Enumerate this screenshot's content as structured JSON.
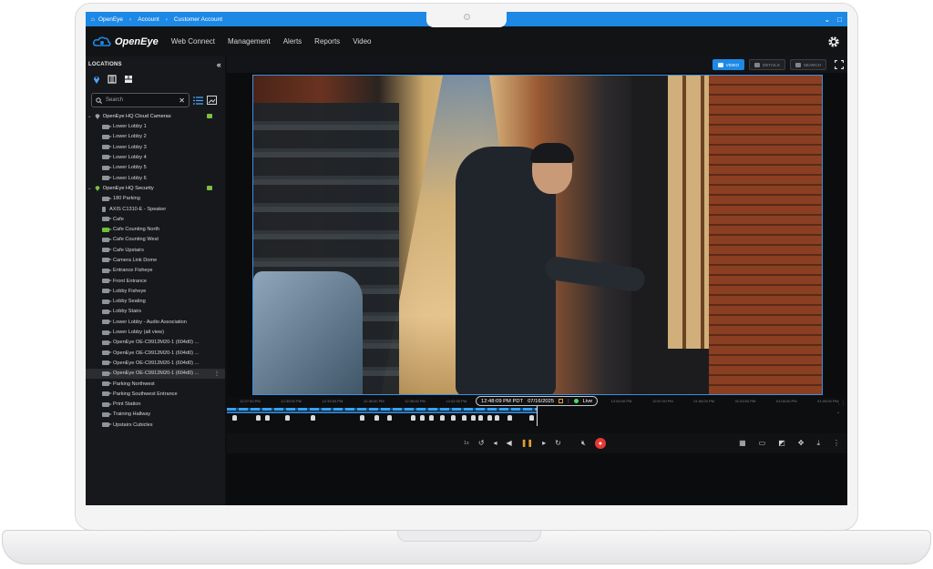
{
  "browser": {
    "crumbs": [
      "OpenEye",
      "Account",
      "Customer Account"
    ]
  },
  "header": {
    "brand": "OpenEye",
    "nav": [
      "Web Connect",
      "Management",
      "Alerts",
      "Reports",
      "Video"
    ]
  },
  "sidebar": {
    "title": "LOCATIONS",
    "search_placeholder": "Search",
    "groups": [
      {
        "label": "OpenEye HQ Cloud Cameras",
        "cameras": [
          "Lower Lobby 1",
          "Lower Lobby 2",
          "Lower Lobby 3",
          "Lower Lobby 4",
          "Lower Lobby 5",
          "Lower Lobby 6"
        ]
      },
      {
        "label": "OpenEye HQ Security",
        "cameras": [
          "180 Parking",
          "AXIS C1310-E - Speaker",
          "Cafe",
          "Cafe Counting North",
          "Cafe Counting West",
          "Cafe Upstairs",
          "Camera Link Dome",
          "Entrance Fisheye",
          "Front Entrance",
          "Lobby Fisheye",
          "Lobby Seating",
          "Lobby Stairs",
          "Lower Lobby - Audio Association",
          "Lower Lobby (alt view)",
          "OpenEye OE-C9912M20-1 (604d0) ...",
          "OpenEye OE-C9912M20-1 (604d0) ...",
          "OpenEye OE-C9912M20-1 (604d0) ...",
          "OpenEye OE-C9912M20-1 (604d0) ...",
          "Parking Northwest",
          "Parking Southwest Entrance",
          "Print Station",
          "Training Hallway",
          "Upstairs Cubicles"
        ]
      }
    ]
  },
  "toolbar": {
    "video": "VIDEO",
    "details": "DETAILS",
    "search": "SEARCH"
  },
  "timeline": {
    "ticks": [
      "12:27:00 PM",
      "12:30:00 PM",
      "12:33:00 PM",
      "12:36:00 PM",
      "12:39:00 PM",
      "12:42:00 PM",
      "12:45:00 PM",
      "12:48:00 PM",
      "12:51:00 PM",
      "12:54:00 PM",
      "12:57:00 PM",
      "01:00:00 PM",
      "01:03:00 PM",
      "01:06:00 PM",
      "01:09:00 PM"
    ],
    "current_time": "12:48:09 PM PDT",
    "current_date": "07/16/2025",
    "live_label": "Live"
  },
  "controls": {
    "speed": "1x"
  },
  "colors": {
    "accent": "#1e88e5",
    "live": "#4cd964",
    "group_online": "#7cc043",
    "record": "#e53935"
  }
}
